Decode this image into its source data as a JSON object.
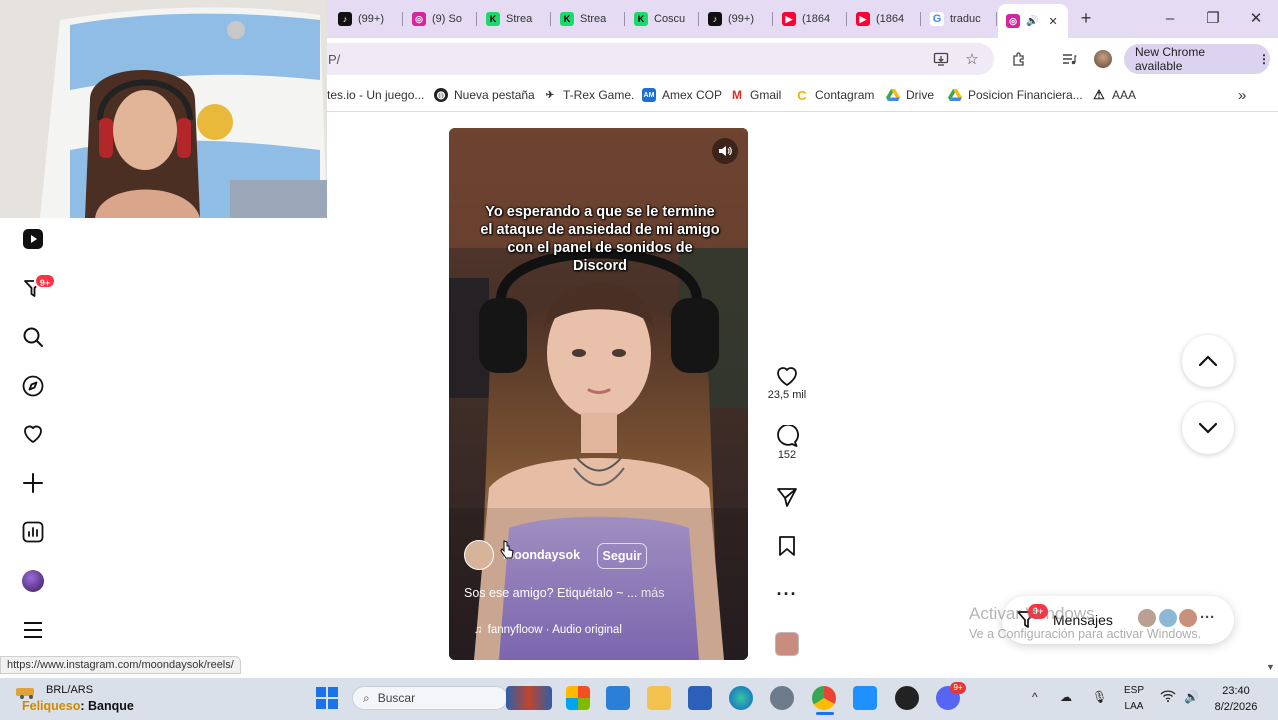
{
  "browser": {
    "tabs": [
      {
        "label": "(99+)",
        "icon": "tiktok-icon"
      },
      {
        "label": "(9) So",
        "icon": "instagram-icon"
      },
      {
        "label": "Strea",
        "icon": "kick-icon"
      },
      {
        "label": "Strea",
        "icon": "kick-icon"
      },
      {
        "label": "Coscu",
        "icon": "kick-icon"
      },
      {
        "label": "(99+)",
        "icon": "tiktok-icon"
      },
      {
        "label": "(1864",
        "icon": "youtube-icon"
      },
      {
        "label": "(1864",
        "icon": "youtube-icon"
      },
      {
        "label": "traduc",
        "icon": "google-icon"
      },
      {
        "label": "",
        "icon": "instagram-icon",
        "active": true
      }
    ],
    "new_tab": "+",
    "window_controls": {
      "minimize": "–",
      "maximize": "❐",
      "close": "✕"
    },
    "address": "P/",
    "new_chrome_label": "New Chrome available",
    "bookmarks": [
      "tes.io - Un juego...",
      "Nueva pestaña",
      "T-Rex Game.",
      "Amex COP",
      "Gmail",
      "Contagram",
      "Drive",
      "Posicion Financiera...",
      "AAA"
    ],
    "bookmarks_more": "»",
    "status_url": "https://www.instagram.com/moondaysok/reels/"
  },
  "instagram": {
    "notif_badge": "9+",
    "reel": {
      "caption_overlay": "Yo esperando a que se le termine el ataque de ansiedad de mi amigo con el panel de sonidos de Discord",
      "author": "moondaysok",
      "follow_label": "Seguir",
      "description": "Sos ese amigo? Etiquétalo ~ ...",
      "more_label": "más",
      "audio": "fannyfloow · Audio original"
    },
    "actions": {
      "likes": "23,5 mil",
      "comments": "152"
    },
    "messages": {
      "label": "Mensajes",
      "badge": "9+"
    }
  },
  "watermark": {
    "line1": "Activar Windows",
    "line2": "Ve a Configuración para activar Windows."
  },
  "taskbar": {
    "ticker_pair": "BRL/ARS",
    "ticker_name_a": "Feliqueso",
    "ticker_name_b": ": Banque",
    "search_placeholder": "Buscar",
    "discord_badge": "9+",
    "lang_line1": "ESP",
    "lang_line2": "LAA",
    "time": "23:40",
    "date": "8/2/2026"
  },
  "colors": {
    "tabstrip": "#e5dcf4",
    "badge_red": "#ff3040",
    "taskbar": "#d9e0ea"
  }
}
